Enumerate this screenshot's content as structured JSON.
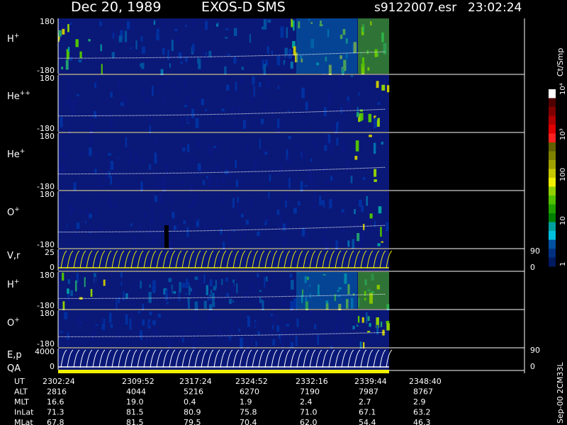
{
  "header": {
    "date": "Dec 20, 1989",
    "mission": "EXOS-D SMS",
    "file": "s9122007.esr",
    "time": "23:02:24"
  },
  "colorbar": {
    "unit": "Ct/Smp",
    "tick_labels": [
      "10⁴",
      "10³",
      "100",
      "10",
      "1"
    ],
    "colors": [
      "#ffffff",
      "#500000",
      "#800000",
      "#b00000",
      "#e00000",
      "#ff2020",
      "#606000",
      "#808000",
      "#a0a000",
      "#c8c800",
      "#f0f000",
      "#90d000",
      "#50c000",
      "#20a000",
      "#008000",
      "#00a0a0",
      "#00c0e0",
      "#0050a0",
      "#003080",
      "#001a60"
    ]
  },
  "side_text": "Sep-00 2CM33L",
  "panels": [
    {
      "id": "h-plus-1",
      "label": "H",
      "sup": "+",
      "ytop": "180",
      "ybot": "-180",
      "right_top": "",
      "right_bot": ""
    },
    {
      "id": "he-plus-plus",
      "label": "He",
      "sup": "++",
      "ytop": "180",
      "ybot": "-180",
      "right_top": "",
      "right_bot": ""
    },
    {
      "id": "he-plus",
      "label": "He",
      "sup": "+",
      "ytop": "180",
      "ybot": "-180",
      "right_top": "",
      "right_bot": ""
    },
    {
      "id": "o-plus-1",
      "label": "O",
      "sup": "+",
      "ytop": "180",
      "ybot": "-180",
      "right_top": "",
      "right_bot": ""
    },
    {
      "id": "v-r",
      "label": "V,r",
      "sup": "",
      "ytop": "25",
      "ybot": "0",
      "right_top": "90",
      "right_bot": "0"
    },
    {
      "id": "h-plus-2",
      "label": "H",
      "sup": "+",
      "ytop": "180",
      "ybot": "-180",
      "right_top": "",
      "right_bot": ""
    },
    {
      "id": "o-plus-2",
      "label": "O",
      "sup": "+",
      "ytop": "180",
      "ybot": "-180",
      "right_top": "",
      "right_bot": ""
    },
    {
      "id": "e-p",
      "label": "E,p",
      "sup": "",
      "ytop": "4000",
      "ybot": "0",
      "right_top": "90",
      "right_bot": "0"
    }
  ],
  "qa_label": "QA",
  "chart_data": {
    "type": "heatmap",
    "xlabel": "UT",
    "ut_ticks": [
      "2302:24",
      "2309:52",
      "2317:24",
      "2324:52",
      "2332:16",
      "2339:44",
      "2348:40"
    ],
    "rows": [
      {
        "name": "UT",
        "values": [
          "2302:24",
          "2309:52",
          "2317:24",
          "2324:52",
          "2332:16",
          "2339:44",
          "2348:40"
        ]
      },
      {
        "name": "ALT",
        "values": [
          "2816",
          "4044",
          "5216",
          "6270",
          "7190",
          "7987",
          "8767"
        ]
      },
      {
        "name": "MLT",
        "values": [
          "16.6",
          "19.0",
          "0.4",
          "1.9",
          "2.4",
          "2.7",
          "2.9"
        ]
      },
      {
        "name": "InLat",
        "values": [
          "71.3",
          "81.5",
          "80.9",
          "75.8",
          "71.0",
          "67.1",
          "63.2"
        ]
      },
      {
        "name": "MLat",
        "values": [
          "67.8",
          "81.5",
          "79.5",
          "70.4",
          "62.0",
          "54.4",
          "46.3"
        ]
      }
    ]
  }
}
